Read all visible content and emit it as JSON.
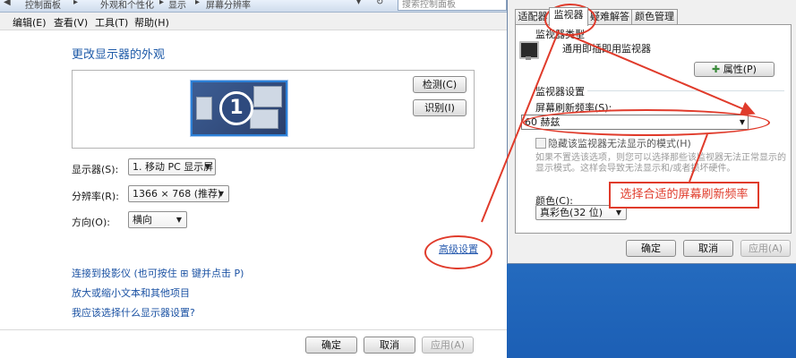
{
  "control_panel": {
    "breadcrumb": [
      "控制面板",
      "外观和个性化",
      "显示",
      "屏幕分辨率"
    ],
    "search_placeholder": "搜索控制面板",
    "menu": [
      "编辑(E)",
      "查看(V)",
      "工具(T)",
      "帮助(H)"
    ],
    "title": "更改显示器的外观",
    "monitor_number": "1",
    "detect_button": "检测(C)",
    "identify_button": "识别(I)",
    "display_label": "显示器(S):",
    "display_value": "1. 移动 PC 显示屏",
    "resolution_label": "分辨率(R):",
    "resolution_value": "1366 × 768 (推荐)",
    "orientation_label": "方向(O):",
    "orientation_value": "横向",
    "advanced_link": "高级设置",
    "links": [
      "连接到投影仪 (也可按住 ⊞ 键并点击 P)",
      "放大或缩小文本和其他项目",
      "我应该选择什么显示器设置?"
    ],
    "ok": "确定",
    "cancel": "取消",
    "apply": "应用(A)"
  },
  "properties_dialog": {
    "tabs": [
      "适配器",
      "监视器",
      "疑难解答",
      "颜色管理"
    ],
    "active_tab": "监视器",
    "monitor_type_label": "监视器类型",
    "monitor_type_value": "通用即插即用监视器",
    "properties_button": "属性(P)",
    "monitor_settings_label": "监视器设置",
    "refresh_rate_label": "屏幕刷新频率(S):",
    "refresh_rate_value": "60 赫兹",
    "hide_modes_label": "隐藏该监视器无法显示的模式(H)",
    "hide_modes_checked": false,
    "note_line1": "如果不置选该选项，则您可以选择那些该监视器无法正常显示的",
    "note_line2": "显示模式。这样会导致无法显示和/或者损坏硬件。",
    "color_label": "颜色(C):",
    "color_value": "真彩色(32 位)",
    "ok": "确定",
    "cancel": "取消",
    "apply": "应用(A)"
  },
  "annotation": {
    "callout_text": "选择合适的屏幕刷新频率",
    "color": "#e03b2b"
  }
}
